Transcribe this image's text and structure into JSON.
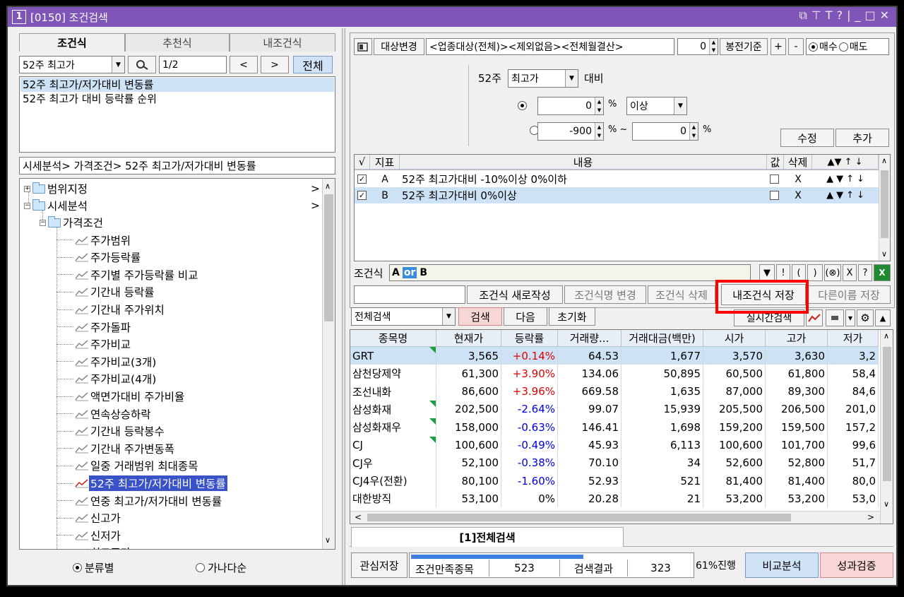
{
  "window": {
    "number": "1",
    "title": "[0150] 조건검색"
  },
  "left": {
    "tabs": [
      "조건식",
      "추천식",
      "내조건식"
    ],
    "condition_select": "52주 최고가",
    "page": "1/2",
    "prev": "<",
    "next": ">",
    "all_button": "전체",
    "list_items": [
      "52주 최고가/저가대비 변동률",
      "52주 최고가 대비 등락률 순위"
    ],
    "breadcrumb": "시세분석> 가격조건> 52주 최고가/저가대비 변동률",
    "tree": [
      {
        "label": "범위지정",
        "arrow": ">"
      },
      {
        "label": "시세분석",
        "arrow": ">"
      },
      {
        "label": "가격조건"
      },
      {
        "label": "주가범위"
      },
      {
        "label": "주가등락률"
      },
      {
        "label": "주기별 주가등락률 비교"
      },
      {
        "label": "기간내 등락률"
      },
      {
        "label": "기간내 주가위치"
      },
      {
        "label": "주가돌파"
      },
      {
        "label": "주가비교"
      },
      {
        "label": "주가비교(3개)"
      },
      {
        "label": "주가비교(4개)"
      },
      {
        "label": "액면가대비 주가비율"
      },
      {
        "label": "연속상승하락"
      },
      {
        "label": "기간내 등락봉수"
      },
      {
        "label": "기간내 주가변동폭"
      },
      {
        "label": "일중 거래범위 최대종목"
      },
      {
        "label": "52주 최고가/저가대비 변동률"
      },
      {
        "label": "연중 최고가/저가대비 변동률"
      },
      {
        "label": "신고가"
      },
      {
        "label": "신저가"
      },
      {
        "label": "최고종가"
      }
    ],
    "sort_options": [
      "분류별",
      "가나다순"
    ]
  },
  "right": {
    "target_change": "대상변경",
    "target_desc": "<업종대상(전체)><제외없음><전체월결산>",
    "bong_value": "0",
    "bong_label": "봉전기준",
    "plus": "+",
    "minus": "-",
    "buy": "매수",
    "sell": "매도",
    "cond_prefix": "52주",
    "cond_select": "최고가",
    "cond_suffix": "대비",
    "row1_value": "0",
    "pct": "%",
    "row1_select": "이상",
    "row2_from": "-900",
    "tilde": "~",
    "row2_to": "0",
    "edit_btn": "수정",
    "add_btn": "추가",
    "ind_headers": {
      "check": "√",
      "ind": "지표",
      "content": "내용",
      "value": "값",
      "del": "삭제"
    },
    "indicators": [
      {
        "ind": "A",
        "content": "52주 최고가대비 -10%이상 0%이하",
        "del": "X"
      },
      {
        "ind": "B",
        "content": "52주 최고가대비 0%이상",
        "del": "X"
      }
    ],
    "formula_label": "조건식",
    "formula": {
      "a": "A",
      "op": "or",
      "b": "B"
    },
    "formula_buttons": [
      "▼",
      "!",
      "(",
      ")",
      "(⊗)",
      "X",
      "?"
    ],
    "action_buttons": [
      "조건식 새로작성",
      "조건식명 변경",
      "조건식 삭제",
      "내조건식 저장",
      "다른이름 저장"
    ],
    "search_select": "전체검색",
    "search_btn": "검색",
    "next_btn": "다음",
    "reset_btn": "초기화",
    "realtime_btn": "실시간검색",
    "grid_headers": [
      "종목명",
      "현재가",
      "등락률",
      "거래량...",
      "거래대금(백만)",
      "시가",
      "고가",
      "저가"
    ],
    "grid_rows": [
      [
        "GRT",
        "3,565",
        "+0.14%",
        "64.53",
        "1,677",
        "3,570",
        "3,630",
        "3,2"
      ],
      [
        "삼천당제약",
        "61,300",
        "+3.90%",
        "134.06",
        "50,895",
        "60,500",
        "61,800",
        "58,4"
      ],
      [
        "조선내화",
        "86,600",
        "+3.96%",
        "669.58",
        "1,635",
        "87,000",
        "89,300",
        "84,6"
      ],
      [
        "삼성화재",
        "202,500",
        "-2.64%",
        "99.07",
        "15,939",
        "205,500",
        "206,500",
        "201,0"
      ],
      [
        "삼성화재우",
        "158,000",
        "-0.63%",
        "146.41",
        "1,698",
        "159,200",
        "159,500",
        "157,2"
      ],
      [
        "CJ",
        "100,600",
        "-0.49%",
        "45.93",
        "6,113",
        "100,600",
        "101,700",
        "99,6"
      ],
      [
        "CJ우",
        "52,100",
        "-0.38%",
        "70.10",
        "34",
        "52,600",
        "52,800",
        "51,7"
      ],
      [
        "CJ4우(전환)",
        "80,100",
        "-1.60%",
        "52.93",
        "521",
        "81,400",
        "81,400",
        "80,0"
      ],
      [
        "대한방직",
        "53,100",
        "0%",
        "20.28",
        "21",
        "53,200",
        "53,200",
        "53,0"
      ]
    ],
    "bottom_tab": "[1]전체검색",
    "save_interest": "관심저장",
    "satisfy_label": "조건만족종목",
    "satisfy_value": "523",
    "result_label": "검색결과",
    "result_value": "323",
    "progress_text": "61%진행",
    "progress_fraction": 0.61,
    "compare_btn": "비교분석",
    "verify_btn": "성과검증"
  },
  "colors": {
    "title_bar": "#7f56b8",
    "highlight": "#ff0000",
    "selected": "#3a52c8",
    "rise": "#e00000",
    "fall": "#0000e0"
  }
}
